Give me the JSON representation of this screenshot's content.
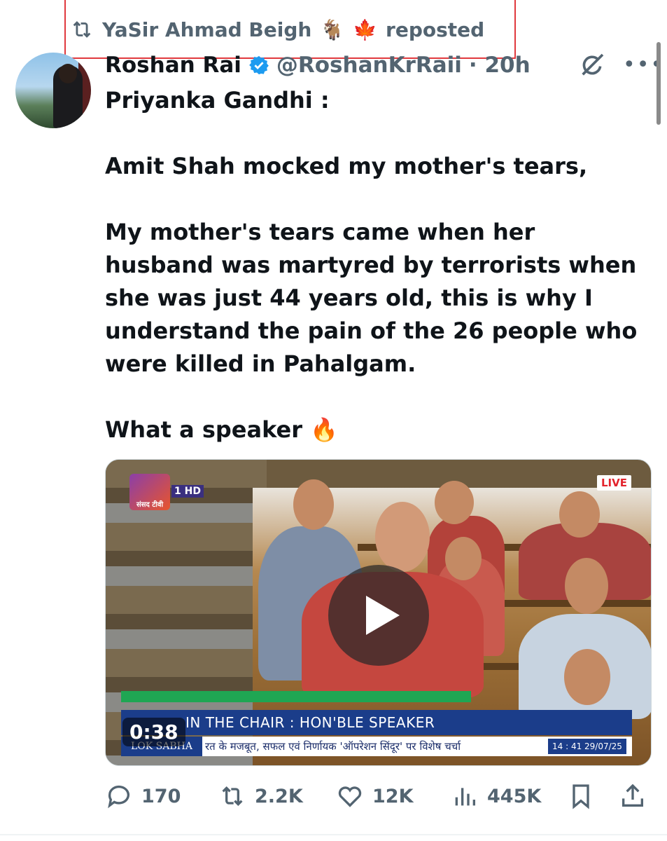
{
  "repost": {
    "user": "YaSir Ahmad Beigh",
    "goat_emoji": "🐐",
    "leaf_emoji": "🍁",
    "label": "reposted"
  },
  "tweet": {
    "author_name": "Roshan Rai",
    "author_handle": "@RoshanKrRaii",
    "time": "· 20h",
    "lines": [
      "Priyanka Gandhi :",
      "Amit Shah mocked my mother's tears,",
      "My mother's tears came when her husband was martyred by terrorists when she was just 44 years old, this is why I understand the pain of the 26 people who were killed in Pahalgam.",
      "What a speaker 🔥"
    ]
  },
  "video": {
    "duration": "0:38",
    "live_label": "LIVE",
    "channel_name": "संसद टीवी",
    "channel_number": "1",
    "channel_hd": "HD",
    "chair_text": "IN THE CHAIR : HON'BLE SPEAKER",
    "ticker_source": "LOK SABHA",
    "ticker_text": "रत के मजबूत, सफल एवं निर्णायक 'ऑपरेशन सिंदूर' पर विशेष चर्चा",
    "ticker_date": "14 : 41   29/07/25"
  },
  "actions": {
    "replies": "170",
    "reposts": "2.2K",
    "likes": "12K",
    "views": "445K"
  },
  "colors": {
    "text": "#0f1419",
    "muted": "#536471",
    "verified": "#1d9bf0",
    "highlight_box": "#e0393e"
  }
}
